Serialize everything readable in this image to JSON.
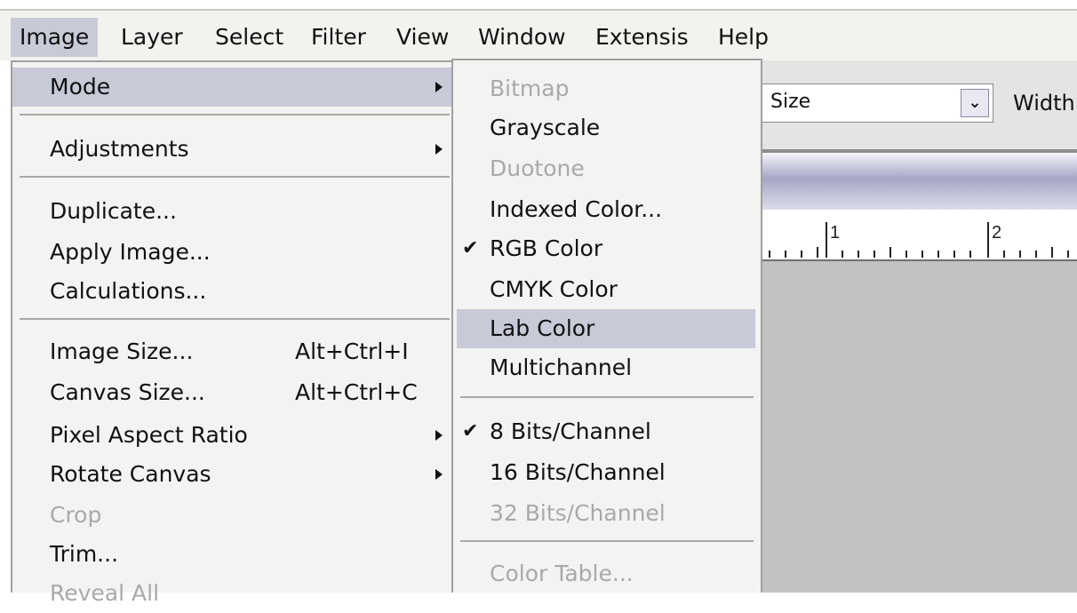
{
  "menubar": {
    "items": [
      "Image",
      "Layer",
      "Select",
      "Filter",
      "View",
      "Window",
      "Extensis",
      "Help"
    ]
  },
  "options_bar": {
    "size_select": "Size",
    "width_label": "Width"
  },
  "ruler": {
    "labels": [
      "1",
      "2"
    ]
  },
  "image_menu": {
    "items": [
      {
        "label": "Mode",
        "submenu": true
      },
      {
        "label": "Adjustments",
        "submenu": true
      },
      {
        "label": "Duplicate..."
      },
      {
        "label": "Apply Image..."
      },
      {
        "label": "Calculations..."
      },
      {
        "label": "Image Size...",
        "shortcut": "Alt+Ctrl+I"
      },
      {
        "label": "Canvas Size...",
        "shortcut": "Alt+Ctrl+C"
      },
      {
        "label": "Pixel Aspect Ratio",
        "submenu": true
      },
      {
        "label": "Rotate Canvas",
        "submenu": true
      },
      {
        "label": "Crop",
        "disabled": true
      },
      {
        "label": "Trim..."
      },
      {
        "label": "Reveal All",
        "disabled": true
      }
    ]
  },
  "mode_submenu": {
    "items": [
      {
        "label": "Bitmap",
        "disabled": true
      },
      {
        "label": "Grayscale"
      },
      {
        "label": "Duotone",
        "disabled": true
      },
      {
        "label": "Indexed Color..."
      },
      {
        "label": "RGB Color",
        "checked": true
      },
      {
        "label": "CMYK Color"
      },
      {
        "label": "Lab Color",
        "highlighted": true
      },
      {
        "label": "Multichannel"
      },
      {
        "label": "8 Bits/Channel",
        "checked": true
      },
      {
        "label": "16 Bits/Channel"
      },
      {
        "label": "32 Bits/Channel",
        "disabled": true
      },
      {
        "label": "Color Table...",
        "disabled": true
      }
    ]
  },
  "icons": {
    "submenu_arrow": "triangle-right-icon",
    "check_mark": "check-icon",
    "dropdown": "chevron-down-icon"
  },
  "colors": {
    "highlight": "#c8cad8",
    "disabled_text": "#a9a9a9",
    "menu_bg": "#f3f3f1",
    "canvas": "#c2c2c2"
  }
}
